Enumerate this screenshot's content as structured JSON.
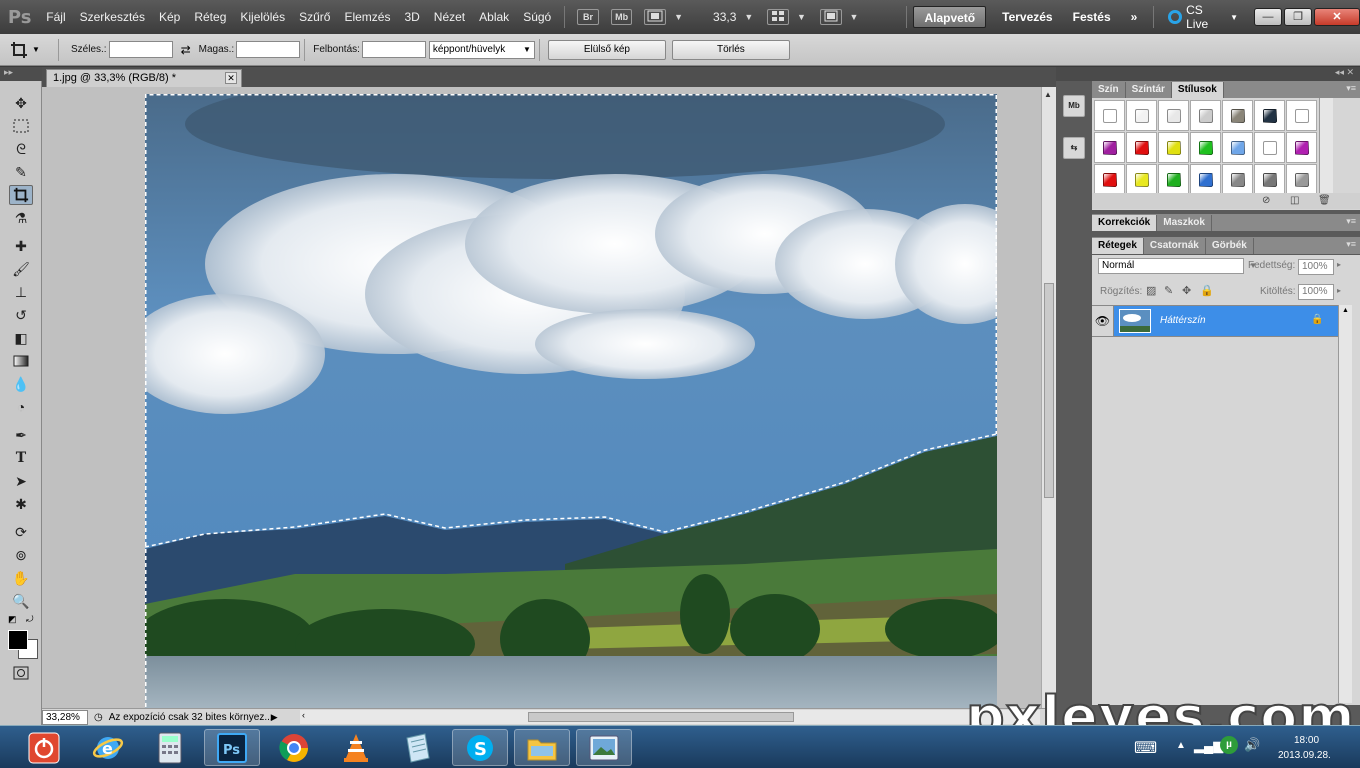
{
  "app": {
    "logo": "Ps"
  },
  "menu": [
    "Fájl",
    "Szerkesztés",
    "Kép",
    "Réteg",
    "Kijelölés",
    "Szűrő",
    "Elemzés",
    "3D",
    "Nézet",
    "Ablak",
    "Súgó"
  ],
  "menubar": {
    "br_label": "Br",
    "mb_label": "Mb",
    "zoom": "33,3"
  },
  "workspaces": {
    "active": "Alapvető",
    "design": "Tervezés",
    "painting": "Festés",
    "more": "»",
    "cs_live": "CS Live"
  },
  "window_controls": {
    "minimize": "—",
    "restore": "❐",
    "close": "✕"
  },
  "options": {
    "width_label": "Széles.:",
    "width_value": "",
    "height_label": "Magas.:",
    "height_value": "",
    "resolution_label": "Felbontás:",
    "resolution_value": "",
    "unit": "képpont/hüvelyk",
    "front_image": "Elülső kép",
    "clear": "Törlés"
  },
  "document": {
    "tab_title": "1.jpg @ 33,3% (RGB/8) *",
    "zoom_field": "33,28%",
    "status": "Az expozíció csak 32 bites környez..."
  },
  "panels": {
    "styles_tabs": [
      "Szín",
      "Színtár",
      "Stílusok"
    ],
    "adjust_tabs": [
      "Korrekciók",
      "Maszkok"
    ],
    "layers_tabs": [
      "Rétegek",
      "Csatornák",
      "Görbék"
    ],
    "blend_mode": "Normál",
    "opacity_label": "Fedettség:",
    "opacity_value": "100%",
    "lock_label": "Rögzítés:",
    "fill_label": "Kitöltés:",
    "fill_value": "100%",
    "layer_name": "Háttérszín"
  },
  "style_swatches": [
    "#ffffff",
    "#f2f2f2",
    "#e8e8e8",
    "#cccccc",
    "#8a8578",
    "#223344",
    "#ffffff",
    "#a020a0",
    "#e01010",
    "#e0e010",
    "#20c020",
    "#6fa6e8",
    "#ffffff",
    "#b020b0",
    "#e01010",
    "#e8e820",
    "#20b020",
    "#3070d0",
    "#888888",
    "#777777",
    "#999999"
  ],
  "watermark": "pxleyes.com",
  "taskbar": {
    "time": "18:00",
    "date": "2013.09.28."
  }
}
